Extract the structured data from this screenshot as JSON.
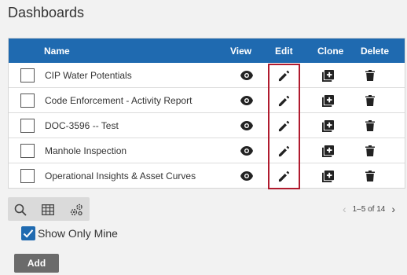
{
  "page": {
    "title": "Dashboards"
  },
  "grid": {
    "columns": {
      "name": "Name",
      "view": "View",
      "edit": "Edit",
      "clone": "Clone",
      "delete": "Delete"
    },
    "rows": [
      {
        "name": "CIP Water Potentials"
      },
      {
        "name": "Code Enforcement - Activity Report"
      },
      {
        "name": "DOC-3596 -- Test"
      },
      {
        "name": "Manhole Inspection"
      },
      {
        "name": "Operational Insights & Asset Curves"
      }
    ],
    "icons": {
      "view": "eye-icon",
      "edit": "pencil-icon",
      "clone": "clone-icon",
      "delete": "trash-icon"
    }
  },
  "toolbar": {
    "icons": [
      "search-icon",
      "columns-icon",
      "settings-icon"
    ]
  },
  "pager": {
    "range": "1–5 of 14"
  },
  "filters": {
    "show_only_mine": "Show Only Mine",
    "show_only_mine_checked": true
  },
  "actions": {
    "add_label": "Add"
  },
  "colors": {
    "header_bg": "#1f6ab0",
    "highlight": "#b01b2e",
    "add_button": "#6b6b6b"
  }
}
